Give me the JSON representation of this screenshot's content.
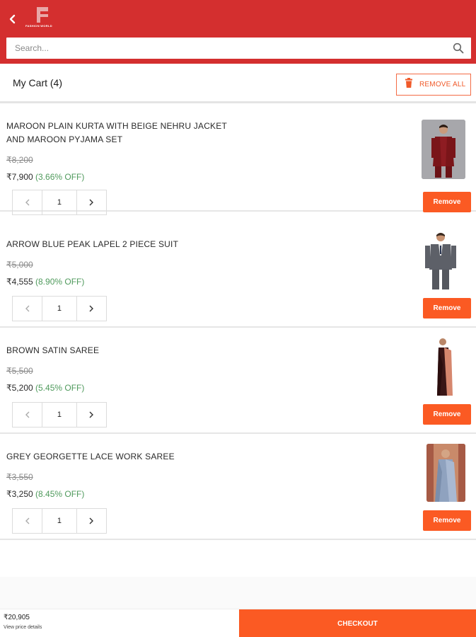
{
  "header": {
    "logo_text": "FASHION WORLD",
    "search_placeholder": "Search..."
  },
  "cart": {
    "title": "My Cart (4)",
    "remove_all_label": "REMOVE ALL"
  },
  "items": [
    {
      "name": "MAROON PLAIN KURTA WITH BEIGE NEHRU JACKET AND MAROON PYJAMA SET",
      "old_price": "₹8,200",
      "price": "₹7,900",
      "discount": "(3.66% OFF)",
      "quantity": "1",
      "remove_label": "Remove",
      "image": "maroon-kurta-image"
    },
    {
      "name": "ARROW BLUE PEAK LAPEL 2 PIECE SUIT",
      "old_price": "₹5,000",
      "price": "₹4,555",
      "discount": "(8.90% OFF)",
      "quantity": "1",
      "remove_label": "Remove",
      "image": "grey-suit-image"
    },
    {
      "name": "BROWN SATIN SAREE",
      "old_price": "₹5,500",
      "price": "₹5,200",
      "discount": "(5.45% OFF)",
      "quantity": "1",
      "remove_label": "Remove",
      "image": "brown-saree-image"
    },
    {
      "name": "GREY GEORGETTE LACE WORK SAREE",
      "old_price": "₹3,550",
      "price": "₹3,250",
      "discount": "(8.45% OFF)",
      "quantity": "1",
      "remove_label": "Remove",
      "image": "grey-saree-image"
    }
  ],
  "footer": {
    "total": "₹20,905",
    "price_details_link": "View price details",
    "checkout_label": "CHECKOUT"
  },
  "colors": {
    "header_red": "#d42f2f",
    "accent_orange": "#fb5a23",
    "discount_green": "#4f9a5c"
  }
}
